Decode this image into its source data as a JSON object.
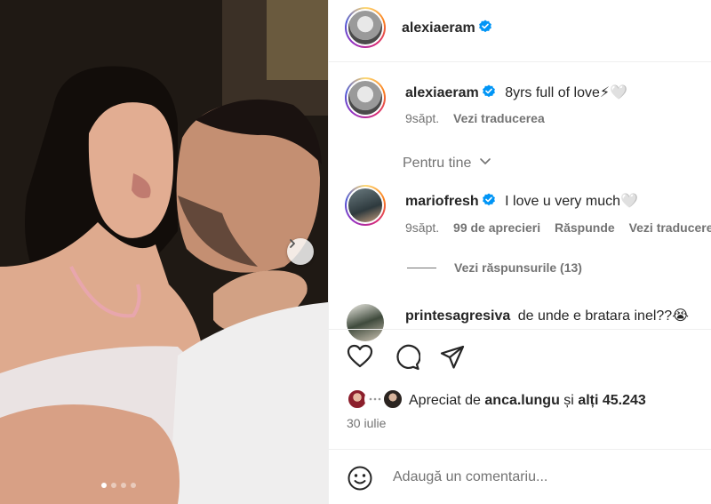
{
  "post": {
    "author": "alexiaeram",
    "caption_author": "alexiaeram",
    "caption_text": "8yrs full of love⚡🤍",
    "caption_time": "9săpt.",
    "translate_label": "Vezi traducerea",
    "carousel_dots": 4,
    "carousel_active": 0
  },
  "section_label": "Pentru tine",
  "comments": [
    {
      "user": "mariofresh",
      "verified": true,
      "text": "I love u very much🤍",
      "time": "9săpt.",
      "likes": "99 de aprecieri",
      "reply_label": "Răspunde",
      "translate_label": "Vezi traducerea",
      "view_replies": "Vezi răspunsurile (13)"
    },
    {
      "user": "printesagresiva",
      "verified": false,
      "text": "de unde e bratara inel??😭"
    }
  ],
  "engagement": {
    "liked_by_prefix": "Apreciat de",
    "liked_by_user": "anca.lungu",
    "liked_by_and": "și",
    "liked_by_others": "alți 45.243",
    "date": "30 iulie"
  },
  "comment_box": {
    "placeholder": "Adaugă un comentariu..."
  },
  "colors": {
    "verified": "#0095f6",
    "text": "#262626",
    "muted": "#737373"
  },
  "icons": [
    "heart-icon",
    "comment-icon",
    "share-icon",
    "emoji-icon",
    "verified-icon",
    "chevron-down-icon",
    "chevron-right-icon"
  ]
}
